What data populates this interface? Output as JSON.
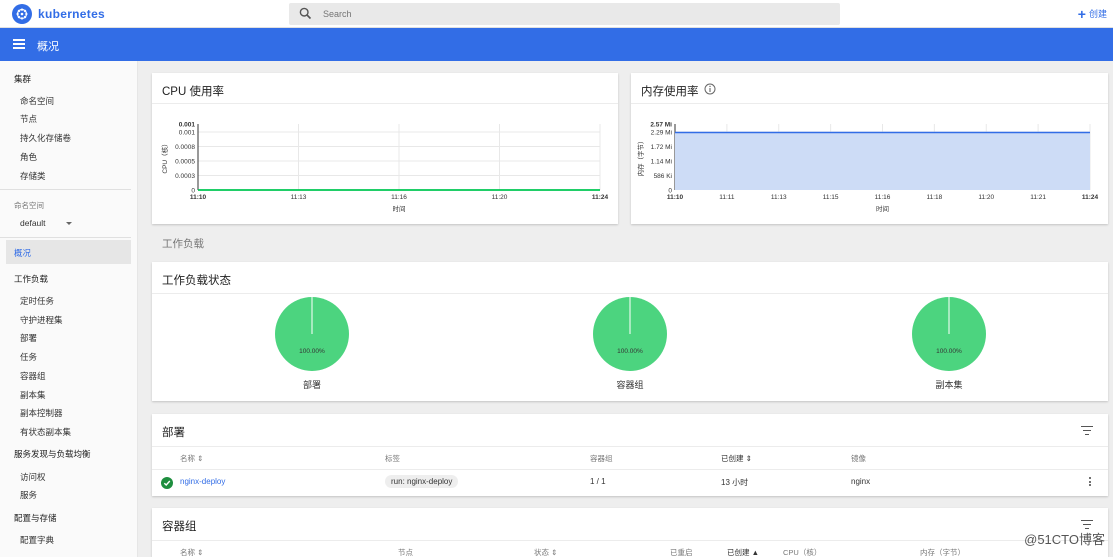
{
  "header": {
    "brand": "kubernetes",
    "search_placeholder": "Search",
    "create_label": "创建"
  },
  "toolbar": {
    "title": "概况"
  },
  "sidebar": {
    "cluster": "集群",
    "cluster_items": [
      "命名空间",
      "节点",
      "持久化存储卷",
      "角色",
      "存储类"
    ],
    "namespace_label": "命名空间",
    "namespace_value": "default",
    "overview": "概况",
    "workloads": "工作负载",
    "workload_items": [
      "定时任务",
      "守护进程集",
      "部署",
      "任务",
      "容器组",
      "副本集",
      "副本控制器",
      "有状态副本集"
    ],
    "discovery": "服务发现与负载均衡",
    "discovery_items": [
      "访问权",
      "服务"
    ],
    "config": "配置与存储",
    "config_items": [
      "配置字典"
    ]
  },
  "cpu_card": {
    "title": "CPU 使用率"
  },
  "mem_card": {
    "title": "内存使用率"
  },
  "chart_data": [
    {
      "type": "line",
      "title": "CPU 使用率",
      "ylabel": "CPU（核）",
      "xlabel": "时间",
      "x": [
        "11:10",
        "11:13",
        "11:16",
        "11:20",
        "11:24"
      ],
      "yticks": [
        "0",
        "0.0003",
        "0.0005",
        "0.0008",
        "0.001",
        "0.001"
      ],
      "ylim": [
        0,
        0.001
      ],
      "series": [
        {
          "values": [
            0,
            0,
            0,
            0,
            0
          ]
        }
      ],
      "color": "#00c752"
    },
    {
      "type": "area",
      "title": "内存使用率",
      "ylabel": "内存（字节）",
      "xlabel": "时间",
      "x": [
        "11:10",
        "11:11",
        "11:13",
        "11:15",
        "11:16",
        "11:18",
        "11:20",
        "11:21",
        "11:24"
      ],
      "yticks": [
        "0",
        "586 Ki",
        "1.14 Mi",
        "1.72 Mi",
        "2.29 Mi",
        "2.57 Mi"
      ],
      "ylim": [
        0,
        2.57
      ],
      "series": [
        {
          "values": [
            2.27,
            2.27,
            2.27,
            2.27,
            2.27,
            2.27,
            2.27,
            2.27,
            2.27
          ]
        }
      ],
      "color": "#326de6"
    },
    {
      "type": "pie",
      "title": "部署",
      "values": [
        100
      ],
      "value_label": "100.00%"
    },
    {
      "type": "pie",
      "title": "容器组",
      "values": [
        100
      ],
      "value_label": "100.00%"
    },
    {
      "type": "pie",
      "title": "副本集",
      "values": [
        100
      ],
      "value_label": "100.00%"
    }
  ],
  "workloads_section": "工作负载",
  "status_card": {
    "title": "工作负载状态"
  },
  "deploy_card": {
    "title": "部署",
    "headers": [
      "名称",
      "标签",
      "容器组",
      "已创建",
      "镜像"
    ],
    "row": {
      "name": "nginx-deploy",
      "label": "run: nginx-deploy",
      "pods": "1 / 1",
      "created": "13 小时",
      "image": "nginx"
    }
  },
  "pods_card": {
    "title": "容器组",
    "headers": [
      "名称",
      "节点",
      "状态",
      "已重启",
      "已创建",
      "CPU（核）",
      "内存（字节）"
    ]
  },
  "watermark": "@51CTO博客",
  "colors": {
    "primary": "#326de6",
    "pie": "#4cd47f",
    "ok": "#1e8e3e"
  }
}
